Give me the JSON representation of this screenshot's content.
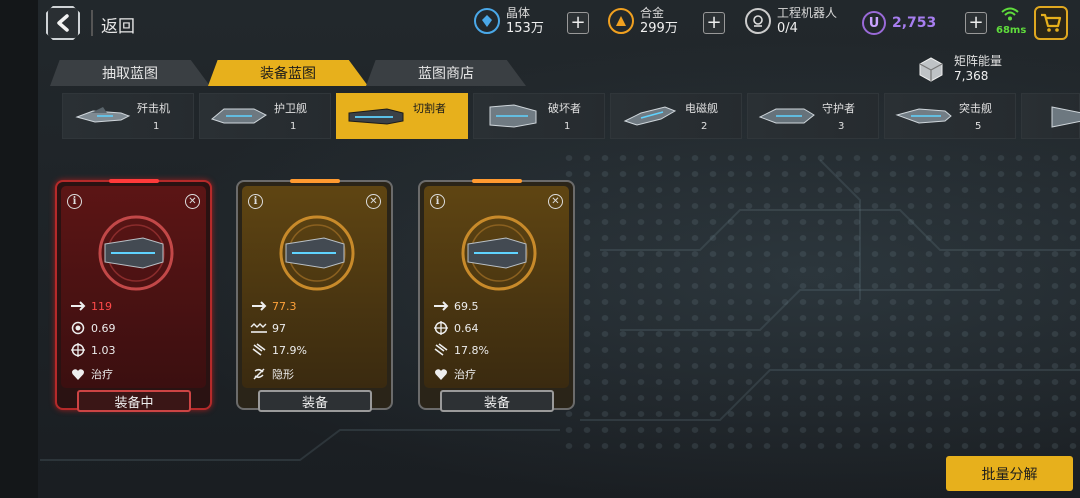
{
  "header": {
    "back_label": "返回",
    "resources": [
      {
        "name": "晶体",
        "value": "153万",
        "icon": "crystal-icon",
        "color": "#4aa8e8"
      },
      {
        "name": "合金",
        "value": "299万",
        "icon": "alloy-icon",
        "color": "#f0a020"
      },
      {
        "name": "工程机器人",
        "value": "0/4",
        "icon": "robot-icon",
        "color": "#dddddd"
      }
    ],
    "premium_currency": {
      "symbol": "U",
      "value": "2,753",
      "color": "#a77ef0"
    },
    "ping": "68ms"
  },
  "tabs": [
    {
      "label": "抽取蓝图",
      "active": false
    },
    {
      "label": "装备蓝图",
      "active": true
    },
    {
      "label": "蓝图商店",
      "active": false
    }
  ],
  "matrix_energy": {
    "label": "矩阵能量",
    "value": "7,368"
  },
  "ship_categories": [
    {
      "name": "歼击机",
      "count": "1",
      "active": false
    },
    {
      "name": "护卫舰",
      "count": "1",
      "active": false
    },
    {
      "name": "切割者",
      "count": "",
      "active": true
    },
    {
      "name": "破坏者",
      "count": "1",
      "active": false
    },
    {
      "name": "电磁舰",
      "count": "2",
      "active": false
    },
    {
      "name": "守护者",
      "count": "3",
      "active": false
    },
    {
      "name": "突击舰",
      "count": "5",
      "active": false
    }
  ],
  "cards": [
    {
      "rarity": "red",
      "stats": [
        {
          "icon": "damage-arrow-icon",
          "value": "119",
          "tone": "red"
        },
        {
          "icon": "target-ring-icon",
          "value": "0.69",
          "tone": "white"
        },
        {
          "icon": "crosshair-icon",
          "value": "1.03",
          "tone": "white"
        }
      ],
      "skill": {
        "icon": "heal-heart-icon",
        "label": "治疗"
      },
      "button": "装备中"
    },
    {
      "rarity": "gold",
      "stats": [
        {
          "icon": "damage-arrow-icon",
          "value": "77.3",
          "tone": "orange"
        },
        {
          "icon": "wave-icon",
          "value": "97",
          "tone": "white"
        },
        {
          "icon": "claw-icon",
          "value": "17.9%",
          "tone": "white"
        }
      ],
      "skill": {
        "icon": "stealth-icon",
        "label": "隐形"
      },
      "button": "装备"
    },
    {
      "rarity": "gold",
      "stats": [
        {
          "icon": "damage-arrow-icon",
          "value": "69.5",
          "tone": "white"
        },
        {
          "icon": "crosshair-icon",
          "value": "0.64",
          "tone": "white"
        },
        {
          "icon": "claw-icon",
          "value": "17.8%",
          "tone": "white"
        }
      ],
      "skill": {
        "icon": "heal-heart-icon",
        "label": "治疗"
      },
      "button": "装备"
    }
  ],
  "bulk_button": "批量分解"
}
